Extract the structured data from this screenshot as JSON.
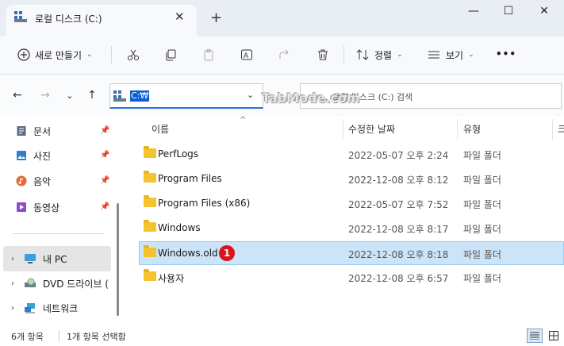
{
  "window": {
    "tab_title": "로컬 디스크 (C:)",
    "close_tab": "✕",
    "new_tab": "+",
    "minimize": "—",
    "maximize": "☐",
    "close": "✕"
  },
  "toolbar": {
    "new_label": "새로 만들기",
    "sort_label": "정렬",
    "view_label": "보기",
    "more": "•••"
  },
  "nav": {
    "address": "C:₩",
    "search_placeholder": "로컬 디스크 (C:) 검색",
    "watermark": "TabMode.com"
  },
  "sidebar": {
    "quick": [
      {
        "label": "문서",
        "icon": "document-icon"
      },
      {
        "label": "사진",
        "icon": "picture-icon"
      },
      {
        "label": "음악",
        "icon": "music-icon"
      },
      {
        "label": "동영상",
        "icon": "video-icon"
      }
    ],
    "tree": [
      {
        "label": "내 PC",
        "icon": "pc-icon"
      },
      {
        "label": "DVD 드라이브 (",
        "icon": "dvd-icon"
      },
      {
        "label": "네트워크",
        "icon": "network-icon"
      }
    ]
  },
  "columns": {
    "name": "이름",
    "modified": "수정한 날짜",
    "type": "유형",
    "size_partial": "크"
  },
  "files": [
    {
      "name": "PerfLogs",
      "modified": "2022-05-07 오후 2:24",
      "type": "파일 폴더"
    },
    {
      "name": "Program Files",
      "modified": "2022-12-08 오후 8:12",
      "type": "파일 폴더"
    },
    {
      "name": "Program Files (x86)",
      "modified": "2022-05-07 오후 7:52",
      "type": "파일 폴더"
    },
    {
      "name": "Windows",
      "modified": "2022-12-08 오후 8:17",
      "type": "파일 폴더"
    },
    {
      "name": "Windows.old",
      "modified": "2022-12-08 오후 8:18",
      "type": "파일 폴더"
    },
    {
      "name": "사용자",
      "modified": "2022-12-08 오후 6:57",
      "type": "파일 폴더"
    }
  ],
  "selected_badge": "1",
  "status": {
    "count": "6개 항목",
    "selected": "1개 항목 선택함"
  },
  "colors": {
    "accent": "#0b5ed7",
    "selection": "#cce4f7",
    "folder": "#f4c430",
    "badge": "#d9141e"
  }
}
